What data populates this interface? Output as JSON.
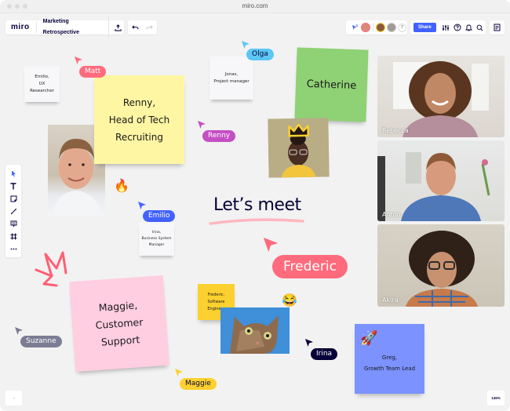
{
  "browser": {
    "url": "miro.com"
  },
  "header": {
    "logo": "miro",
    "board_title": "Marketing Retrospective",
    "upload_icon": "upload-icon",
    "undo_icon": "undo-icon",
    "redo_icon": "redo-icon",
    "collaborator_count": "7",
    "share_label": "Share",
    "icons": [
      "cursor-follow-icon",
      "settings-sliders-icon",
      "help-icon",
      "bell-icon",
      "search-icon",
      "notes-icon"
    ]
  },
  "toolbar": {
    "tools": [
      "select",
      "text",
      "sticky-note",
      "pen",
      "comment",
      "frame",
      "more"
    ]
  },
  "canvas": {
    "heading": "Let’s meet",
    "stickies": {
      "renny": "Renny,\nHead of Tech\nRecruiting",
      "catherine": "Catherine",
      "maggie": "Maggie,\nCustomer\nSupport",
      "frederic": "Frederic,\nSoftware\nEngineer",
      "greg": "Greg,\nGrowth Team Lead"
    },
    "cards": {
      "emilio": "Emilio,\nUX\nResearcher",
      "jonas": "Jonas,\nProject manager",
      "irina": "Irina,\nBusiness System\nManager"
    },
    "cursors": [
      {
        "name": "Matt",
        "color": "#ff6b7d"
      },
      {
        "name": "Olga",
        "color": "#5cc6f5"
      },
      {
        "name": "Renny",
        "color": "#c44fc5"
      },
      {
        "name": "Emilio",
        "color": "#4262ff"
      },
      {
        "name": "Frederic",
        "color": "#ff6b7d"
      },
      {
        "name": "Suzanne",
        "color": "#7c7c94"
      },
      {
        "name": "Maggie",
        "color": "#fcd02f"
      },
      {
        "name": "Irina",
        "color": "#050038"
      }
    ],
    "emojis": {
      "fire": "🔥",
      "laugh": "😂",
      "rocket": "🚀"
    }
  },
  "video_call": {
    "participants": [
      {
        "name": "Rebecca"
      },
      {
        "name": "Anton"
      },
      {
        "name": "Akira"
      }
    ]
  },
  "footer": {
    "zoom_level": "145%",
    "minimap_toggle": "»"
  },
  "colors": {
    "accent": "#4262ff",
    "yellow_sticky": "#fff6a3",
    "green_sticky": "#8fd175",
    "pink_sticky": "#ffcee0",
    "orange_sticky": "#fcd02f",
    "blue_sticky": "#7b92ff"
  }
}
